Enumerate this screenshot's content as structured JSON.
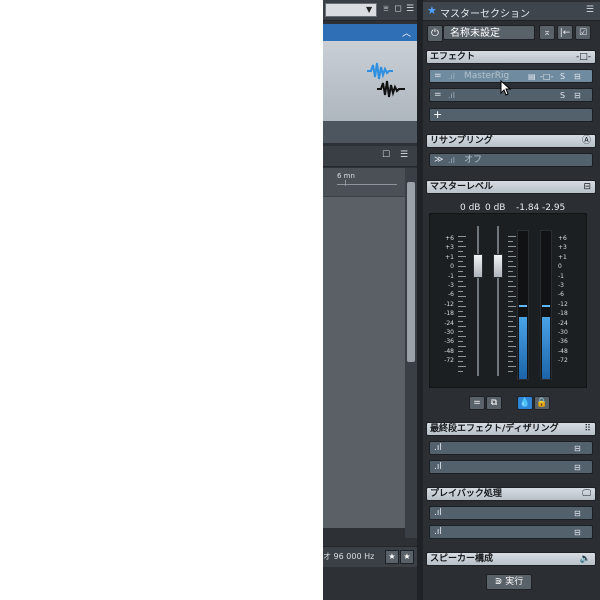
{
  "editor": {
    "ruler_label": "6 mn",
    "status_rate": "オ 96 000 Hz"
  },
  "master": {
    "title": "マスターセクション",
    "preset_name": "名称未設定",
    "effects": {
      "title": "エフェクト",
      "slot1_name": "MasterRig",
      "add_label": "+"
    },
    "resampling": {
      "title": "リサンプリング",
      "value": "オフ"
    },
    "master_level": {
      "title": "マスターレベル",
      "gain_left": "0 dB",
      "gain_right": "0 dB",
      "peak_left": "-1.84",
      "peak_right": "-2.95",
      "scale": [
        "+6",
        "+3",
        "+1",
        "0",
        "-1",
        "-3",
        "-6",
        "-12",
        "-18",
        "-24",
        "-30",
        "-36",
        "-48",
        "-72"
      ],
      "meter_left_fill": 0.42,
      "meter_right_fill": 0.42
    },
    "final_effects": {
      "title": "最終段エフェクト/ディザリング"
    },
    "playback": {
      "title": "プレイバック処理"
    },
    "speakers": {
      "title": "スピーカー構成"
    },
    "run_label": "実行"
  },
  "colors": {
    "accent": "#2f6fb6",
    "meter_blue": "#4aa3e8"
  }
}
